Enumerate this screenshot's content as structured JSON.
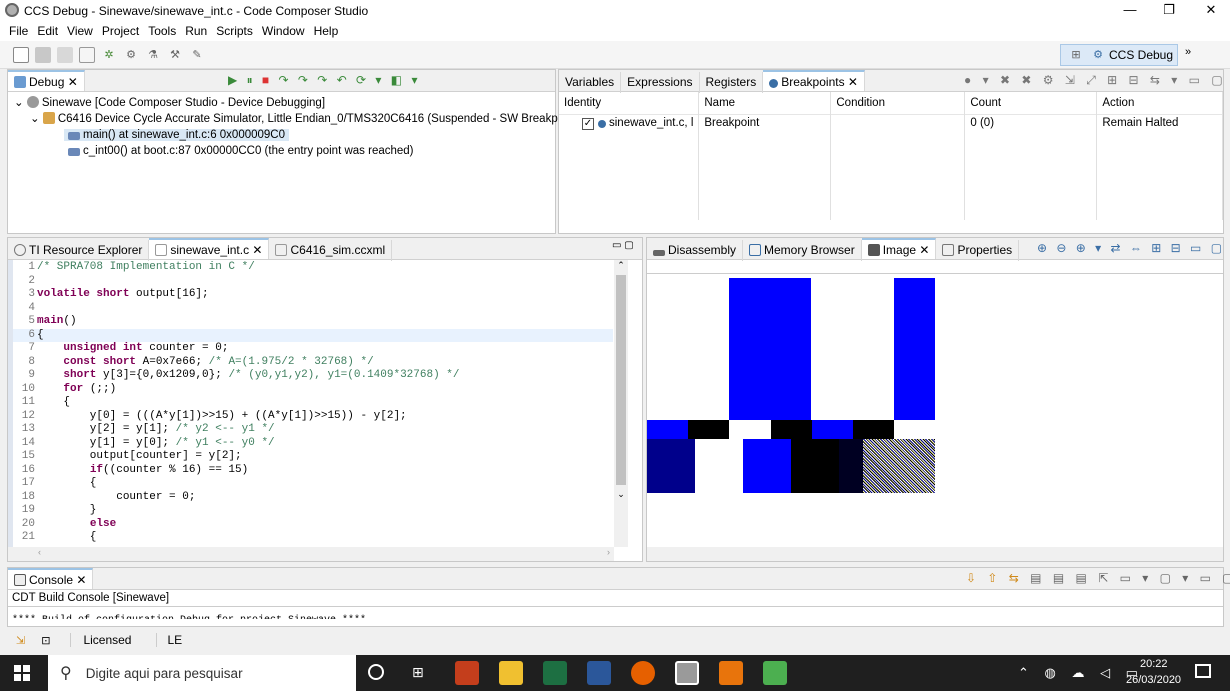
{
  "window": {
    "title": "CCS Debug - Sinewave/sinewave_int.c - Code Composer Studio",
    "minimize": "—",
    "maximize": "❐",
    "close": "✕"
  },
  "menu": [
    "File",
    "Edit",
    "View",
    "Project",
    "Tools",
    "Run",
    "Scripts",
    "Window",
    "Help"
  ],
  "perspective": {
    "label": "CCS Debug",
    "more": "»"
  },
  "debug_panel": {
    "tab": "Debug",
    "items": [
      "Sinewave [Code Composer Studio - Device Debugging]",
      "C6416 Device Cycle Accurate Simulator, Little Endian_0/TMS320C6416 (Suspended - SW Breakpoint)",
      "main() at sinewave_int.c:6 0x000009C0",
      "c_int00() at boot.c:87 0x00000CC0  (the entry point was reached)"
    ]
  },
  "breakpoints_panel": {
    "tabs": [
      "Variables",
      "Expressions",
      "Registers",
      "Breakpoints"
    ],
    "columns": [
      "Identity",
      "Name",
      "Condition",
      "Count",
      "Action"
    ],
    "rows": [
      {
        "identity": "sinewave_int.c, l",
        "name": "Breakpoint",
        "condition": "",
        "count": "0 (0)",
        "action": "Remain Halted"
      }
    ]
  },
  "editor": {
    "tabs": [
      "TI Resource Explorer",
      "sinewave_int.c",
      "C6416_sim.ccxml"
    ],
    "lines": [
      {
        "n": "1",
        "html": "<span class='cm'>/* SPRA708 Implementation in C */</span>"
      },
      {
        "n": "2",
        "html": ""
      },
      {
        "n": "3",
        "html": "<span class='kw'>volatile short</span> output[16];"
      },
      {
        "n": "4",
        "html": ""
      },
      {
        "n": "5",
        "html": "<span class='kw'>main</span>()"
      },
      {
        "n": "6",
        "html": "{"
      },
      {
        "n": "7",
        "html": "    <span class='kw'>unsigned int</span> counter = 0;"
      },
      {
        "n": "8",
        "html": "    <span class='kw'>const short</span> A=0x7e66; <span class='cm'>/* A=(1.975/2 * 32768) */</span>"
      },
      {
        "n": "9",
        "html": "    <span class='kw'>short</span> y[3]={0,0x1209,0}; <span class='cm'>/* (y0,y1,y2), y1=(0.1409*32768) */</span>"
      },
      {
        "n": "10",
        "html": "    <span class='kw'>for</span> (;;)"
      },
      {
        "n": "11",
        "html": "    {"
      },
      {
        "n": "12",
        "html": "        y[0] = (((A*y[1])>>15) + ((A*y[1])>>15)) - y[2];"
      },
      {
        "n": "13",
        "html": "        y[2] = y[1]; <span class='cm'>/* y2 &lt;-- y1 */</span>"
      },
      {
        "n": "14",
        "html": "        y[1] = y[0]; <span class='cm'>/* y1 &lt;-- y0 */</span>"
      },
      {
        "n": "15",
        "html": "        output[counter] = y[2];"
      },
      {
        "n": "16",
        "html": "        <span class='kw'>if</span>((counter % 16) == 15)"
      },
      {
        "n": "17",
        "html": "        {"
      },
      {
        "n": "18",
        "html": "            counter = 0;"
      },
      {
        "n": "19",
        "html": "        }"
      },
      {
        "n": "20",
        "html": "        <span class='kw'>else</span>"
      },
      {
        "n": "21",
        "html": "        {"
      }
    ]
  },
  "image_panel": {
    "tabs": [
      "Disassembly",
      "Memory Browser",
      "Image",
      "Properties"
    ]
  },
  "console": {
    "tab": "Console",
    "title": "CDT Build Console [Sinewave]",
    "text": "**** Build of configuration Debug for project Sinewave ****"
  },
  "status": {
    "license": "Licensed",
    "endian": "LE"
  },
  "taskbar": {
    "search": "Digite aqui para pesquisar",
    "time": "20:22",
    "date": "26/03/2020"
  }
}
